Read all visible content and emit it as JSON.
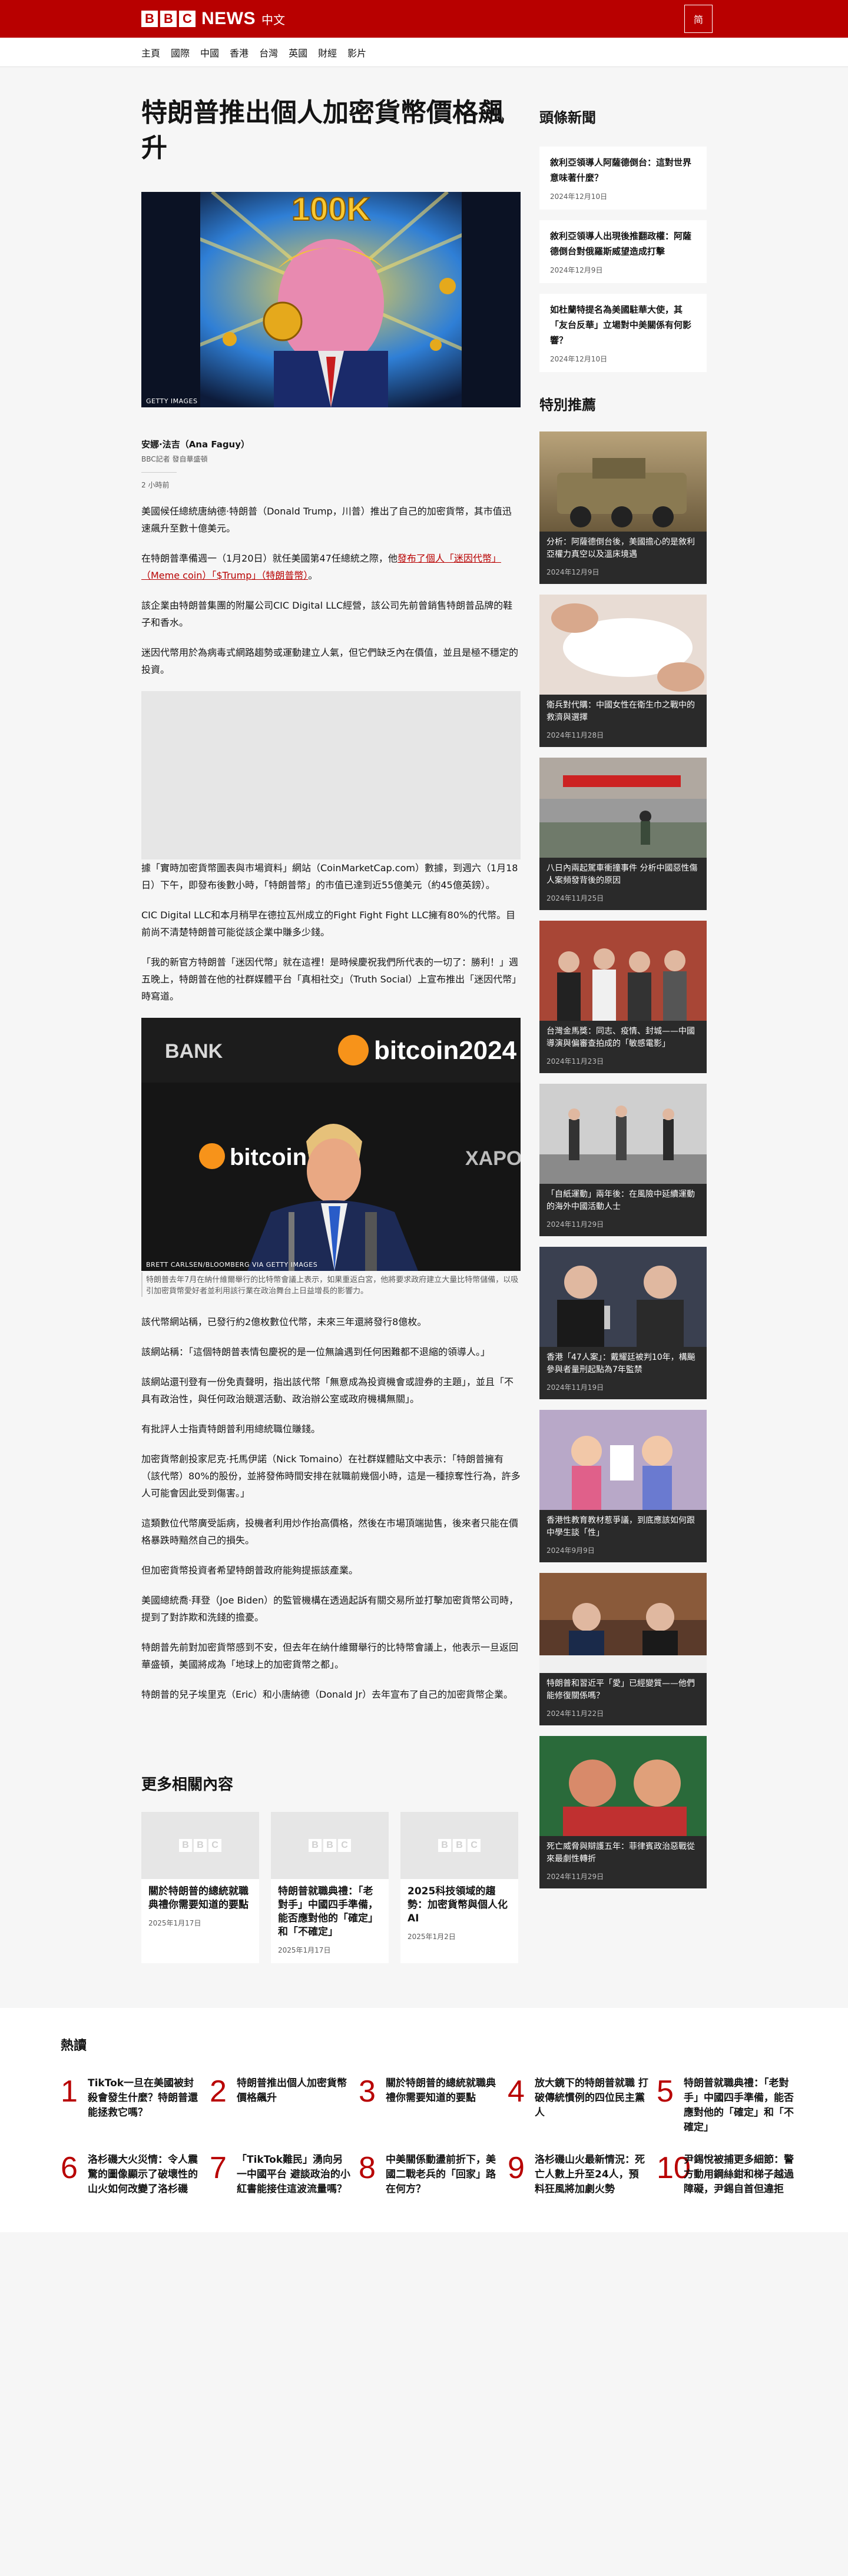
{
  "header": {
    "brand_blocks": [
      "B",
      "B",
      "C"
    ],
    "brand_news": "NEWS",
    "brand_lang": "中文",
    "lang_button": "简"
  },
  "nav": [
    "主頁",
    "國際",
    "中國",
    "香港",
    "台灣",
    "英國",
    "財經",
    "影片"
  ],
  "article": {
    "headline": "特朗普推出個人加密貨幣價格飆升",
    "hero_credit": "GETTY IMAGES",
    "hero_sign": "100K",
    "author": "安娜·法吉（Ana Faguy）",
    "author_role": "BBC記者 發自華盛頓",
    "time": "2 小時前",
    "p1": "美國候任總統唐納德·特朗普（Donald Trump，川普）推出了自己的加密貨幣，其市值迅速飆升至數十億美元。",
    "p2_before": "在特朗普準備週一（1月20日）就任美國第47任總統之際，他",
    "p2_link": "發布了個人「迷因代幣」（Meme coin）「$Trump」（特朗普幣）",
    "p2_after": "。",
    "p3": "該企業由特朗普集團的附屬公司CIC Digital LLC經營，該公司先前曾銷售特朗普品牌的鞋子和香水。",
    "p4": "迷因代幣用於為病毒式網路趨勢或運動建立人氣，但它們缺乏內在價值，並且是極不穩定的投資。",
    "p5": "據「實時加密貨幣圖表與市場資料」網站（CoinMarketCap.com）數據，到週六（1月18日）下午，即發布後數小時，「特朗普幣」的市值已達到近55億美元（約45億英鎊）。",
    "p6": "CIC Digital LLC和本月稍早在德拉瓦州成立的Fight Fight Fight LLC擁有80%的代幣。目前尚不清楚特朗普可能從該企業中賺多少錢。",
    "p7": "「我的新官方特朗普「迷因代幣」就在這裡！是時候慶祝我們所代表的一切了：勝利！」週五晚上，特朗普在他的社群媒體平台「真相社交」（Truth Social）上宣布推出「迷因代幣」時寫道。",
    "fig2_credit": "BRETT CARLSEN/BLOOMBERG VIA GETTY IMAGES",
    "fig2_caption": "特朗普去年7月在納什維爾舉行的比特幣會議上表示，如果重返白宮，他將要求政府建立大量比特幣儲備，以吸引加密貨幣愛好者並利用該行業在政治舞台上日益增長的影響力。",
    "fig2_bitcoin": "bitcoin2024",
    "fig2_bank": "BANK",
    "fig2_xapo": "XAPO",
    "p8": "該代幣網站稱，已發行約2億枚數位代幣，未來三年還將發行8億枚。",
    "p9": "該網站稱：「這個特朗普表情包慶祝的是一位無論遇到任何困難都不退縮的領導人。」",
    "p10": "該網站還刊登有一份免責聲明，指出該代幣「無意成為投資機會或證券的主題」，並且「不具有政治性，與任何政治競選活動、政治辦公室或政府機構無關」。",
    "p11": "有批評人士指責特朗普利用總統職位賺錢。",
    "p12": "加密貨幣創投家尼克·托馬伊諾（Nick Tomaino）在社群媒體貼文中表示：「特朗普擁有（該代幣）80%的股份，並將發佈時間安排在就職前幾個小時，這是一種掠奪性行為，許多人可能會因此受到傷害。」",
    "p13": "這類數位代幣廣受詬病，投機者利用炒作抬高價格，然後在市場頂端拋售，後來者只能在價格暴跌時黯然自己的損失。",
    "p14": "但加密貨幣投資者希望特朗普政府能夠提振該產業。",
    "p15": "美國總統喬·拜登（Joe Biden）的監管機構在透過起訴有關交易所並打擊加密貨幣公司時，提到了對詐欺和洗錢的擔憂。",
    "p16": "特朗普先前對加密貨幣感到不安，但去年在納什維爾舉行的比特幣會議上，他表示一旦返回華盛頓，美國將成為「地球上的加密貨幣之都」。",
    "p17": "特朗普的兒子埃里克（Eric）和小唐納德（Donald Jr）去年宣布了自己的加密貨幣企業。"
  },
  "more": {
    "title": "更多相關內容",
    "cards": [
      {
        "headline": "關於特朗普的總統就職典禮你需要知道的要點",
        "date": "2025年1月17日"
      },
      {
        "headline": "特朗普就職典禮：「老對手」中國四手準備，能否應對他的「確定」和「不確定」",
        "date": "2025年1月17日"
      },
      {
        "headline": "2025科技領域的趨勢：加密貨幣與個人化AI",
        "date": "2025年1月2日"
      }
    ]
  },
  "sidebar": {
    "top_title": "頭條新聞",
    "top_items": [
      {
        "headline": "敘利亞領導人阿薩德倒台：這對世界意味著什麼？",
        "date": "2024年12月10日"
      },
      {
        "headline": "敘利亞領導人出現後推翻政權：阿薩德倒台對俄羅斯威望造成打擊",
        "date": "2024年12月9日"
      },
      {
        "headline": "如杜蘭特提名為美國駐華大使，其「友台反華」立場對中美關係有何影響？",
        "date": "2024年12月10日"
      }
    ],
    "rec_title": "特別推薦",
    "rec_items": [
      {
        "headline": "分析：阿薩德倒台後，美國擔心的是敘利亞權力真空以及溫床境遇",
        "date": "2024年12月9日"
      },
      {
        "headline": "衛兵對代購：中國女性在衛生巾之戰中的救濟與選擇",
        "date": "2024年11月28日"
      },
      {
        "headline": "八日內兩起駕車衝撞事件 分析中國惡性傷人案頻發背後的原因",
        "date": "2024年11月25日"
      },
      {
        "headline": "台灣金馬獎：同志、疫情、封城——中國導演與偏審查拍成的「敏感電影」",
        "date": "2024年11月23日"
      },
      {
        "headline": "「自紙運動」兩年後：在風險中延續運動的海外中國活動人士",
        "date": "2024年11月29日"
      },
      {
        "headline": "香港「47人案」：戴耀廷被判10年，構飈參與者量刑起點為7年監禁",
        "date": "2024年11月19日"
      },
      {
        "headline": "香港性教育教材惹爭議，到底應該如何跟中學生談「性」",
        "date": "2024年9月9日"
      },
      {
        "headline": "特朗普和習近平「愛」已經變質——他們能修復關係嗎？",
        "date": "2024年11月22日"
      },
      {
        "headline": "死亡威脅與辯護五年：菲律賓政治惡戰從來最劇性轉折",
        "date": "2024年11月29日"
      }
    ]
  },
  "popular": {
    "title": "熱讀",
    "items": [
      {
        "num": "1",
        "text": "TikTok一旦在美國被封殺會發生什麼？特朗普還能拯救它嗎？"
      },
      {
        "num": "2",
        "text": "特朗普推出個人加密貨幣價格飆升"
      },
      {
        "num": "3",
        "text": "關於特朗普的總統就職典禮你需要知道的要點"
      },
      {
        "num": "4",
        "text": "放大鏡下的特朗普就職 打破傳統慣例的四位民主黨人"
      },
      {
        "num": "5",
        "text": "特朗普就職典禮：「老對手」中國四手準備，能否應對他的「確定」和「不確定」"
      },
      {
        "num": "6",
        "text": "洛杉磯大火災情：令人震驚的圖像顯示了破壞性的山火如何改變了洛杉磯"
      },
      {
        "num": "7",
        "text": "「TikTok難民」湧向另一中國平台 避談政治的小紅書能接住這波流量嗎？"
      },
      {
        "num": "8",
        "text": "中美關係動盪前折下，美國二戰老兵的「回家」路在何方？"
      },
      {
        "num": "9",
        "text": "洛杉磯山火最新情況：死亡人數上升至24人，預料狂風將加劇火勢"
      },
      {
        "num": "10",
        "text": "尹錫悅被捕更多細節：警方動用鋼絲鉗和梯子越過障礙，尹錫自首但違拒"
      }
    ]
  }
}
